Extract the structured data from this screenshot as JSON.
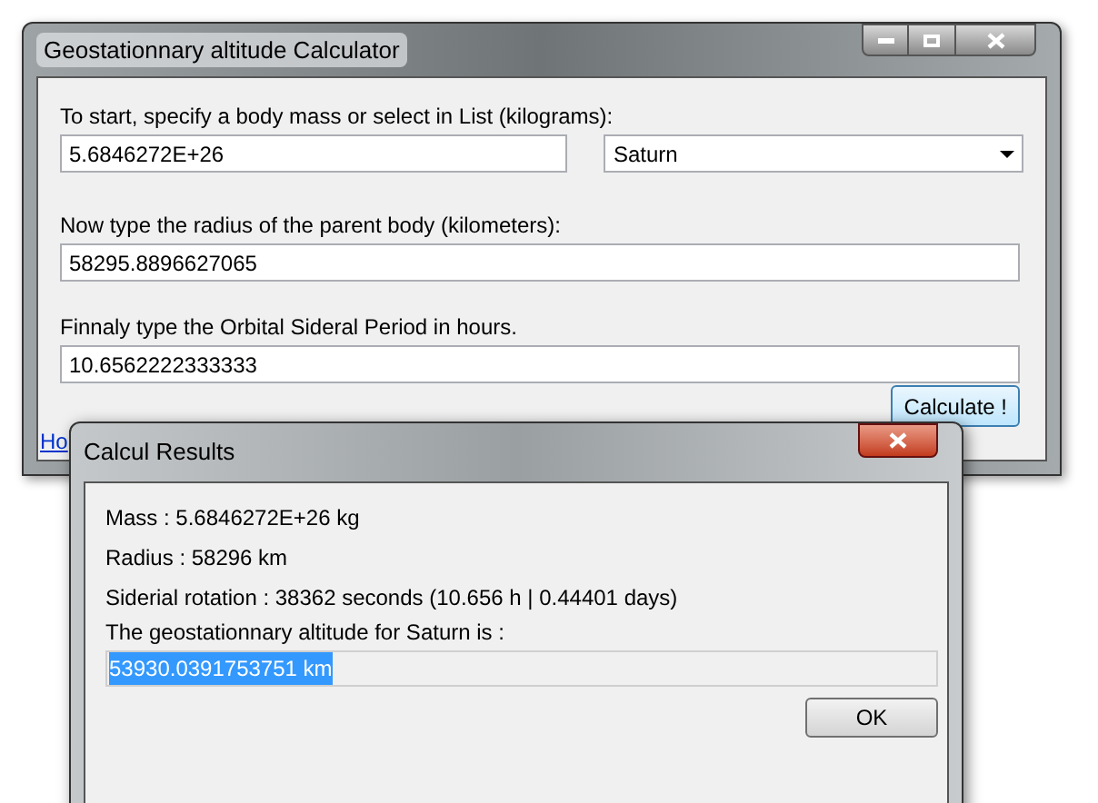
{
  "main_window": {
    "title": "Geostationnary altitude Calculator",
    "mass": {
      "label": "To start, specify a body mass or select in List (kilograms):",
      "value": "5.6846272E+26",
      "body": "Saturn"
    },
    "radius": {
      "label": "Now type the radius of the parent body (kilometers):",
      "value": "58295.8896627065"
    },
    "period": {
      "label": "Finnaly type the Orbital Sideral Period in hours.",
      "value": "10.6562222333333"
    },
    "calculate_button": "Calculate !",
    "link": "Ho"
  },
  "dialog": {
    "title": "Calcul Results",
    "lines": [
      "Mass : 5.6846272E+26 kg",
      "Radius : 58296 km",
      "Siderial rotation : 38362 seconds (10.656 h | 0.44401 days)",
      "The geostationnary altitude for Saturn is :"
    ],
    "result": "53930.0391753751 km",
    "result_selected": true,
    "ok_button": "OK"
  }
}
